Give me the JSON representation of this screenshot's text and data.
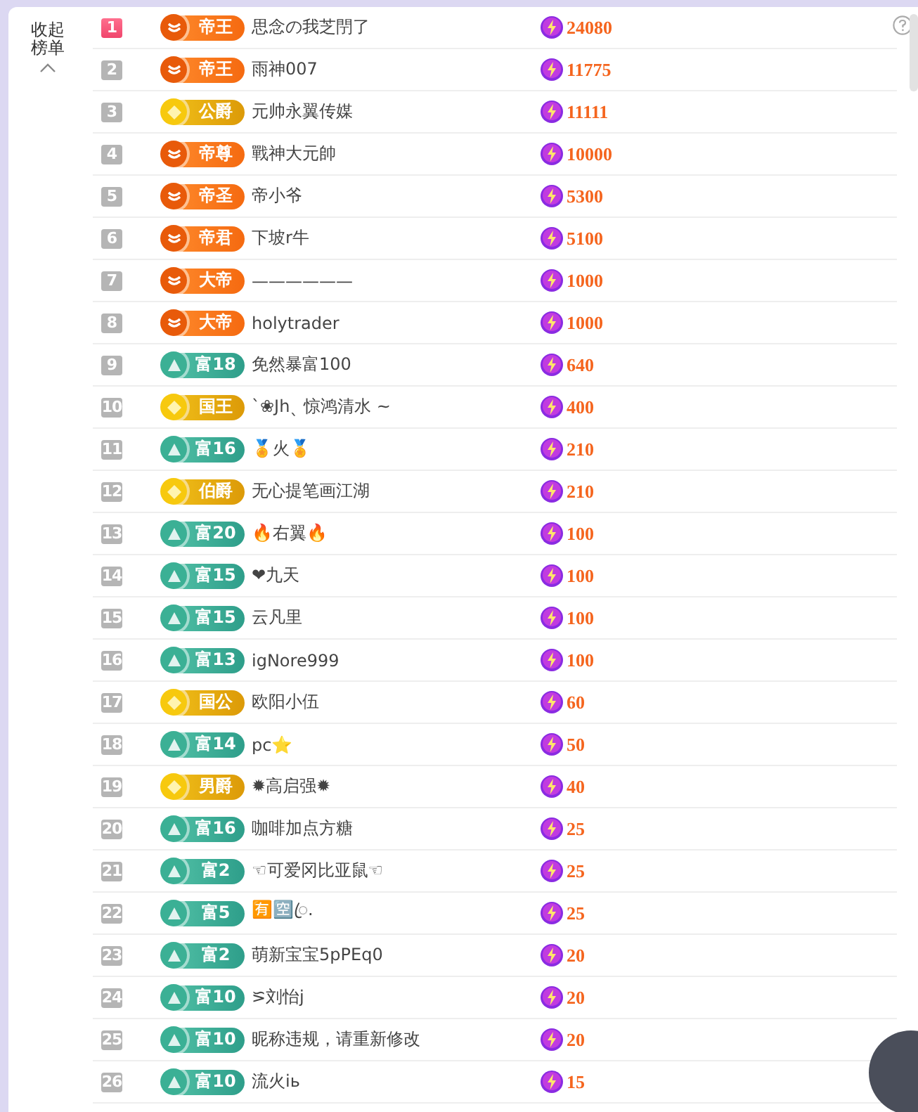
{
  "sidebar": {
    "collapse_label": "收起榜单"
  },
  "rows": [
    {
      "rank": "1",
      "highlighted": true,
      "badge": {
        "kind": "emperor",
        "label": "帝王"
      },
      "name": "思念の我芝閅了",
      "score": "24080"
    },
    {
      "rank": "2",
      "highlighted": false,
      "badge": {
        "kind": "emperor",
        "label": "帝王"
      },
      "name": "雨神007",
      "score": "11775"
    },
    {
      "rank": "3",
      "highlighted": false,
      "badge": {
        "kind": "noble",
        "label": "公爵"
      },
      "name": "元帅永翼传媒",
      "score": "11111"
    },
    {
      "rank": "4",
      "highlighted": false,
      "badge": {
        "kind": "emperor",
        "label": "帝尊"
      },
      "name": "戰神大元帥",
      "score": "10000"
    },
    {
      "rank": "5",
      "highlighted": false,
      "badge": {
        "kind": "emperor",
        "label": "帝圣"
      },
      "name": "帝小爷",
      "score": "5300"
    },
    {
      "rank": "6",
      "highlighted": false,
      "badge": {
        "kind": "emperor",
        "label": "帝君"
      },
      "name": "下坡r牛",
      "score": "5100"
    },
    {
      "rank": "7",
      "highlighted": false,
      "badge": {
        "kind": "emperor",
        "label": "大帝"
      },
      "name": "——————",
      "score": "1000"
    },
    {
      "rank": "8",
      "highlighted": false,
      "badge": {
        "kind": "emperor",
        "label": "大帝"
      },
      "name": "holytrader",
      "score": "1000"
    },
    {
      "rank": "9",
      "highlighted": false,
      "badge": {
        "kind": "rich",
        "label": "富18"
      },
      "name": "免然暴富100",
      "score": "640"
    },
    {
      "rank": "10",
      "highlighted": false,
      "badge": {
        "kind": "noble",
        "label": "国王"
      },
      "name": "ˋ❀Jhˎ 惊鸿清水 ~",
      "score": "400"
    },
    {
      "rank": "11",
      "highlighted": false,
      "badge": {
        "kind": "rich",
        "label": "富16"
      },
      "name": "🏅火🏅",
      "score": "210"
    },
    {
      "rank": "12",
      "highlighted": false,
      "badge": {
        "kind": "noble",
        "label": "伯爵"
      },
      "name": "无心提笔画江湖",
      "score": "210"
    },
    {
      "rank": "13",
      "highlighted": false,
      "badge": {
        "kind": "rich",
        "label": "富20"
      },
      "name": "🔥右翼🔥",
      "score": "100"
    },
    {
      "rank": "14",
      "highlighted": false,
      "badge": {
        "kind": "rich",
        "label": "富15"
      },
      "name": "❤九天",
      "score": "100"
    },
    {
      "rank": "15",
      "highlighted": false,
      "badge": {
        "kind": "rich",
        "label": "富15"
      },
      "name": "云凡里",
      "score": "100"
    },
    {
      "rank": "16",
      "highlighted": false,
      "badge": {
        "kind": "rich",
        "label": "富13"
      },
      "name": "igNore999",
      "score": "100"
    },
    {
      "rank": "17",
      "highlighted": false,
      "badge": {
        "kind": "noble",
        "label": "国公"
      },
      "name": "欧阳小伍",
      "score": "60"
    },
    {
      "rank": "18",
      "highlighted": false,
      "badge": {
        "kind": "rich",
        "label": "富14"
      },
      "name": "pc⭐",
      "score": "50"
    },
    {
      "rank": "19",
      "highlighted": false,
      "badge": {
        "kind": "noble",
        "label": "男爵"
      },
      "name": "✹高启强✹",
      "score": "40"
    },
    {
      "rank": "20",
      "highlighted": false,
      "badge": {
        "kind": "rich",
        "label": "富16"
      },
      "name": "咖啡加点方糖",
      "score": "25"
    },
    {
      "rank": "21",
      "highlighted": false,
      "badge": {
        "kind": "rich",
        "label": "富2"
      },
      "name": "☜可爱冈比亚鼠☜",
      "score": "25"
    },
    {
      "rank": "22",
      "highlighted": false,
      "badge": {
        "kind": "rich",
        "label": "富5"
      },
      "name": "🈶🈳ꦿ.",
      "score": "25"
    },
    {
      "rank": "23",
      "highlighted": false,
      "badge": {
        "kind": "rich",
        "label": "富2"
      },
      "name": "萌新宝宝5pPEq0",
      "score": "20"
    },
    {
      "rank": "24",
      "highlighted": false,
      "badge": {
        "kind": "rich",
        "label": "富10"
      },
      "name": "⪞刘怡j",
      "score": "20"
    },
    {
      "rank": "25",
      "highlighted": false,
      "badge": {
        "kind": "rich",
        "label": "富10"
      },
      "name": "昵称违规，请重新修改",
      "score": "20"
    },
    {
      "rank": "26",
      "highlighted": false,
      "badge": {
        "kind": "rich",
        "label": "富10"
      },
      "name": "流火iь",
      "score": "15"
    }
  ]
}
